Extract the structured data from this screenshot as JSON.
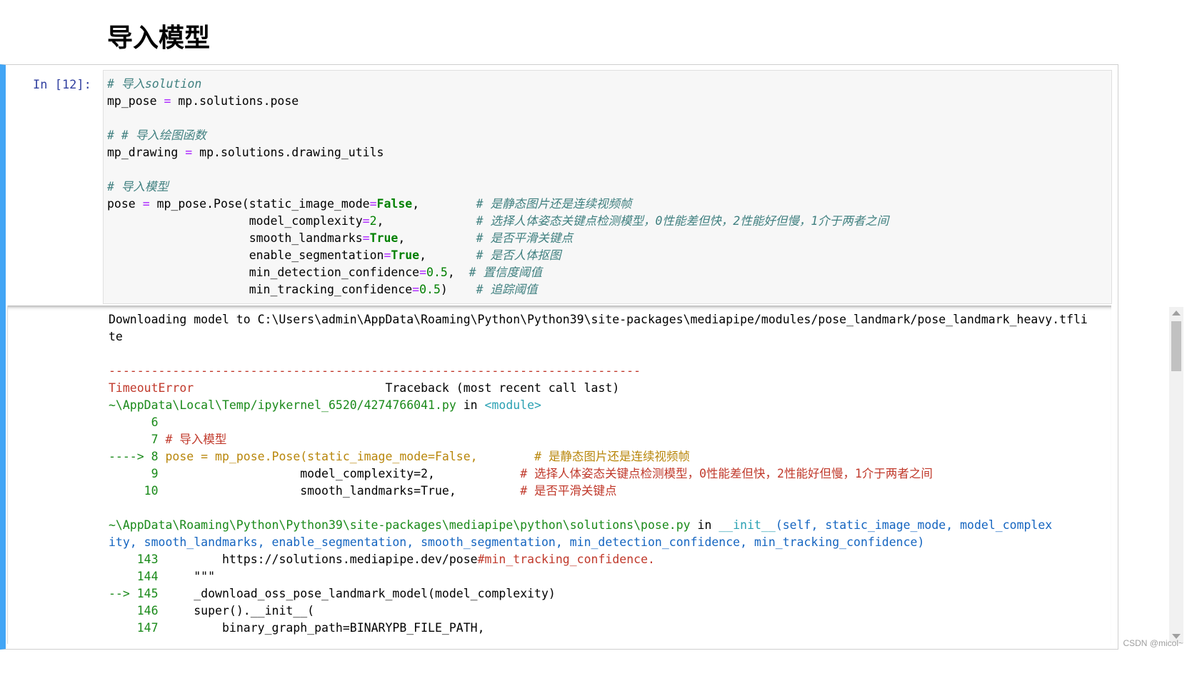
{
  "heading": "导入模型",
  "prompt": "In  [12]:",
  "code": {
    "c1": "# 导入solution",
    "l2_a": "mp_pose",
    "eq": "=",
    "l2_b": "mp.solutions.pose",
    "c2": "# # 导入绘图函数",
    "l4_a": "mp_drawing",
    "l4_b": "mp.solutions.drawing_utils",
    "c3": "# 导入模型",
    "l6_a": "pose",
    "l6_b": "mp_pose.Pose(static_image_mode",
    "false": "False",
    "true": "True",
    "c_static": "# 是静态图片还是连续视频帧",
    "l7": "model_complexity",
    "n2": "2",
    "c_complexity": "# 选择人体姿态关键点检测模型，0性能差但快，2性能好但慢，1介于两者之间",
    "l8": "smooth_landmarks",
    "c_smooth": "# 是否平滑关键点",
    "l9": "enable_segmentation",
    "c_seg": "# 是否人体抠图",
    "l10": "min_detection_confidence",
    "n05": "0.5",
    "c_det": "# 置信度阈值",
    "l11": "min_tracking_confidence",
    "c_track": "# 追踪阈值"
  },
  "output": {
    "download1": "Downloading model to C:\\Users\\admin\\AppData\\Roaming\\Python\\Python39\\site-packages\\mediapipe/modules/pose_landmark/pose_landmark_heavy.tfli",
    "download2": "te",
    "dashes": "---------------------------------------------------------------------------",
    "error_name": "TimeoutError",
    "traceback": "Traceback (most recent call last)",
    "file1": "~\\AppData\\Local\\Temp/ipykernel_6520/4274766041.py",
    "in": "in",
    "module": "<module>",
    "ln6": "6",
    "ln7": "7",
    "ln7_code": "# 导入模型",
    "arrow8": "---->",
    "ln8": "8",
    "ln8_a": "pose",
    "ln8_b": "mp_pose.Pose(static_image_mode=False,",
    "ln8_c": "# 是静态图片还是连续视频帧",
    "ln9": "9",
    "ln9_a": "model_complexity=2,",
    "ln9_c": "# 选择人体姿态关键点检测模型，0性能差但快，2性能好但慢，1介于两者之间",
    "ln10": "10",
    "ln10_a": "smooth_landmarks=True,",
    "ln10_c": "# 是否平滑关键点",
    "file2": "~\\AppData\\Roaming\\Python\\Python39\\site-packages\\mediapipe\\python\\solutions\\pose.py",
    "init": "__init__",
    "sig1": "(self, static_image_mode, model_complex",
    "sig2": "ity, smooth_landmarks, enable_segmentation, smooth_segmentation, min_detection_confidence, min_tracking_confidence)",
    "ln143": "143",
    "ln143_a": "https://solutions.mediapipe.dev/pose",
    "ln143_b": "#min_tracking_confidence.",
    "ln144": "144",
    "ln144_a": "\"\"\"",
    "arrow145": "-->",
    "ln145": "145",
    "ln145_a": "_download_oss_pose_landmark_model(model_complexity)",
    "ln146": "146",
    "ln146_a": "super().__init__(",
    "ln147": "147",
    "ln147_a": "binary_graph_path=BINARYPB_FILE_PATH,"
  },
  "watermark": "CSDN @micol~",
  "colors": {
    "cell_border": "#42a5f5",
    "prompt": "#303f9f",
    "error": "#c0392b"
  }
}
